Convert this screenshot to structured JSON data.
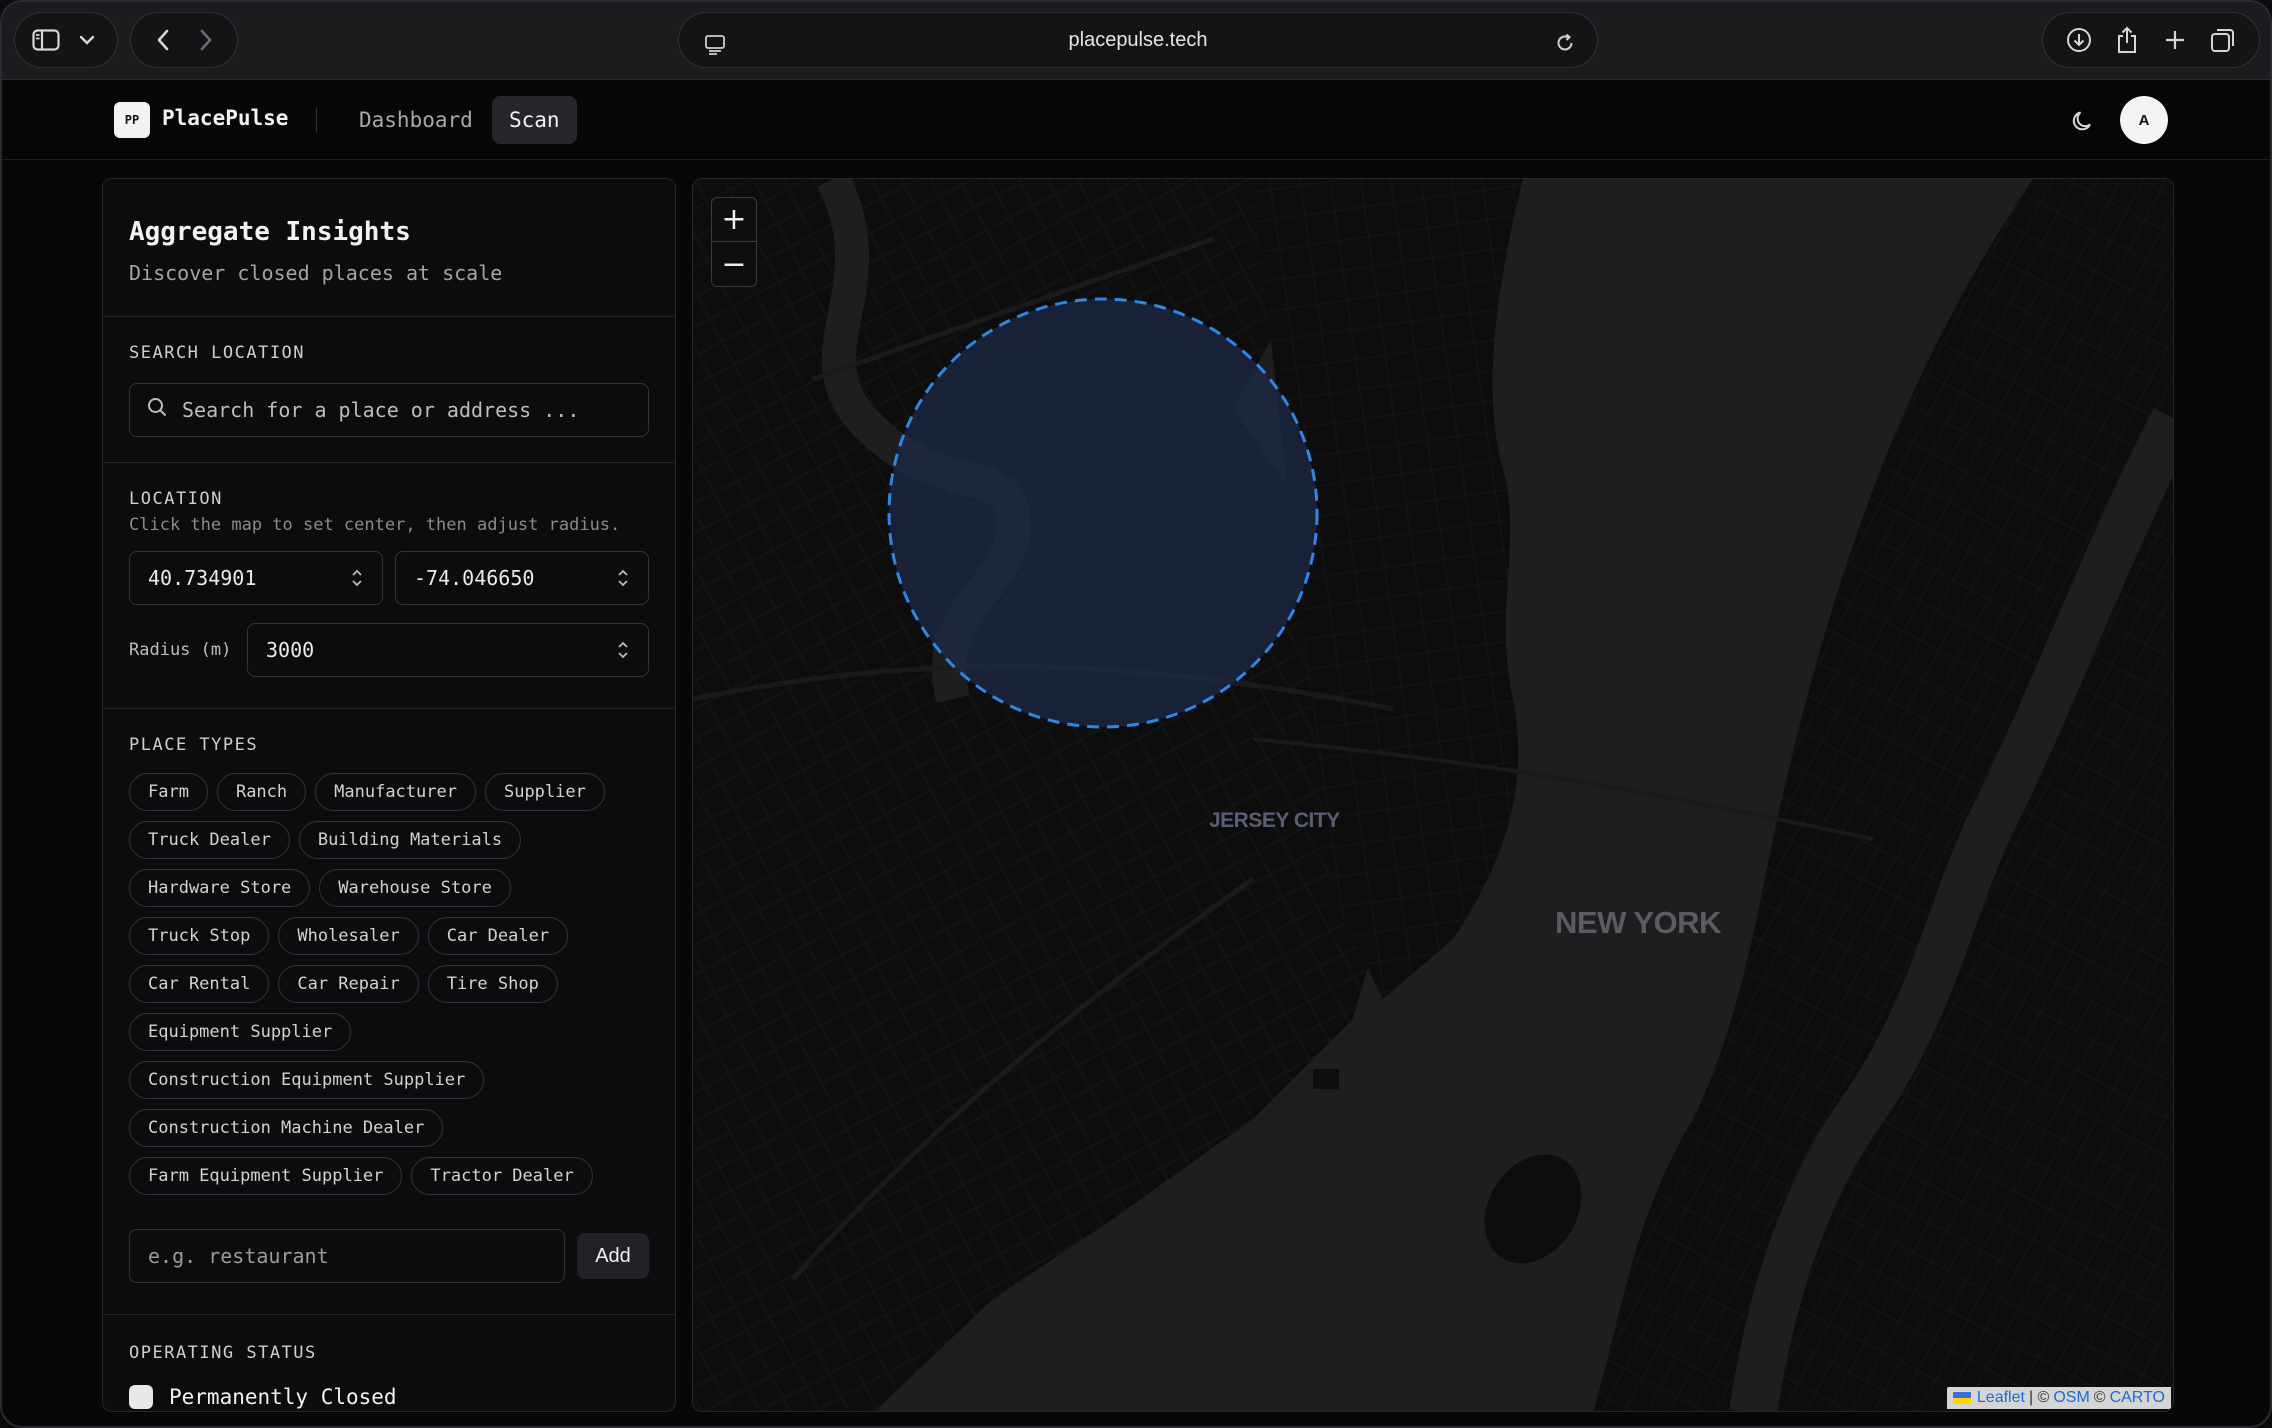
{
  "browser": {
    "url": "placepulse.tech",
    "icons": [
      "sidebar-icon",
      "chevron-down-icon",
      "back-icon",
      "forward-icon",
      "reader-icon",
      "reload-icon",
      "download-icon",
      "share-icon",
      "new-tab-icon",
      "tabs-overview-icon"
    ]
  },
  "app": {
    "logo_badge": "PP",
    "name": "PlacePulse",
    "nav": {
      "dashboard": "Dashboard",
      "scan": "Scan"
    },
    "avatar_initial": "A"
  },
  "panel": {
    "title": "Aggregate Insights",
    "subtitle": "Discover closed places at scale",
    "search": {
      "label": "SEARCH LOCATION",
      "placeholder": "Search for a place or address ..."
    },
    "location": {
      "label": "LOCATION",
      "hint": "Click the map to set center, then adjust radius.",
      "lat": "40.734901",
      "lng": "-74.046650",
      "radius_label": "Radius (m)",
      "radius": "3000"
    },
    "place_types": {
      "label": "PLACE TYPES",
      "items": [
        "Farm",
        "Ranch",
        "Manufacturer",
        "Supplier",
        "Truck Dealer",
        "Building Materials",
        "Hardware Store",
        "Warehouse Store",
        "Truck Stop",
        "Wholesaler",
        "Car Dealer",
        "Car Rental",
        "Car Repair",
        "Tire Shop",
        "Equipment Supplier",
        "Construction Equipment Supplier",
        "Construction Machine Dealer",
        "Farm Equipment Supplier",
        "Tractor Dealer"
      ],
      "add_placeholder": "e.g. restaurant",
      "add_label": "Add"
    },
    "operating_status": {
      "label": "OPERATING STATUS",
      "option": "Permanently Closed"
    }
  },
  "map": {
    "zoom_in": "+",
    "zoom_out": "−",
    "labels": {
      "jersey_city": "JERSEY CITY",
      "new_york": "NEW YORK"
    },
    "attribution": {
      "leaflet": "Leaflet",
      "sep1": "| ©",
      "osm": "OSM",
      "sep2": "©",
      "carto": "CARTO"
    },
    "circle_color": "#2d87e6"
  }
}
